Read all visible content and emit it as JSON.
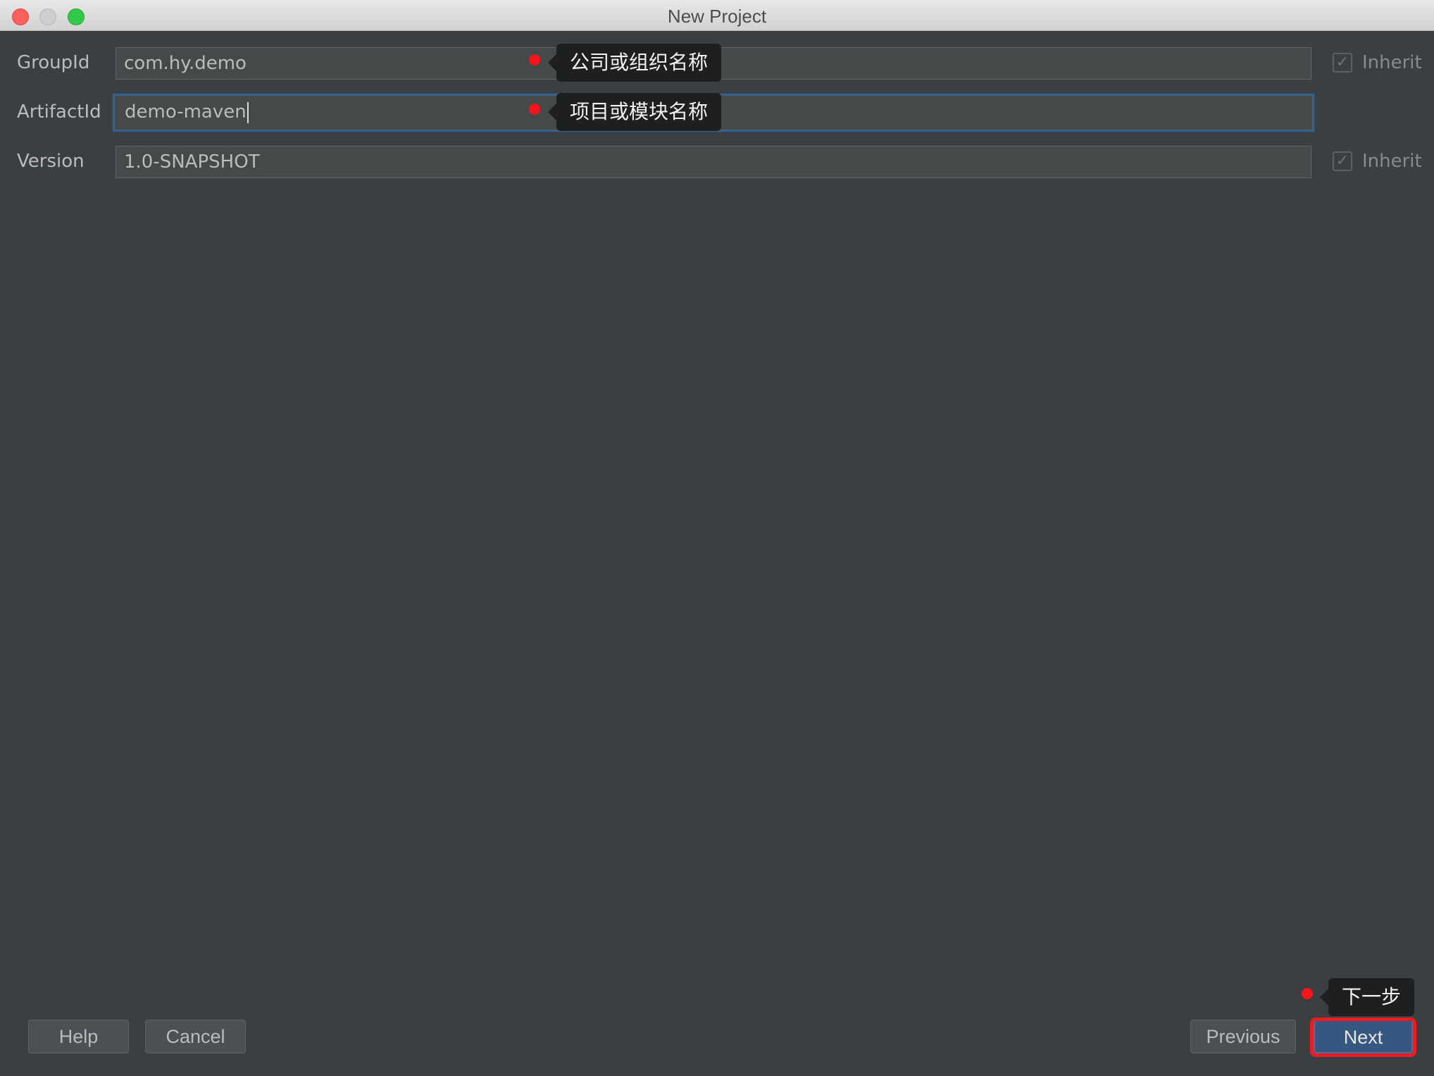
{
  "window": {
    "title": "New Project"
  },
  "fields": {
    "group_id": {
      "label": "GroupId",
      "value": "com.hy.demo",
      "inherit_label": "Inherit",
      "inherit_checked": true
    },
    "artifact_id": {
      "label": "ArtifactId",
      "value": "demo-maven"
    },
    "version": {
      "label": "Version",
      "value": "1.0-SNAPSHOT",
      "inherit_label": "Inherit",
      "inherit_checked": true
    }
  },
  "annotations": {
    "group_id_tip": "公司或组织名称",
    "artifact_id_tip": "项目或模块名称",
    "next_tip": "下一步"
  },
  "buttons": {
    "help": "Help",
    "cancel": "Cancel",
    "previous": "Previous",
    "next": "Next"
  },
  "colors": {
    "background": "#3c3f41",
    "accent": "#365880",
    "annotation_dot": "#f5141d",
    "annotation_highlight": "#ec1c24"
  },
  "icons": [
    "close-window-icon",
    "minimize-window-icon",
    "maximize-window-icon",
    "checkmark-icon"
  ]
}
